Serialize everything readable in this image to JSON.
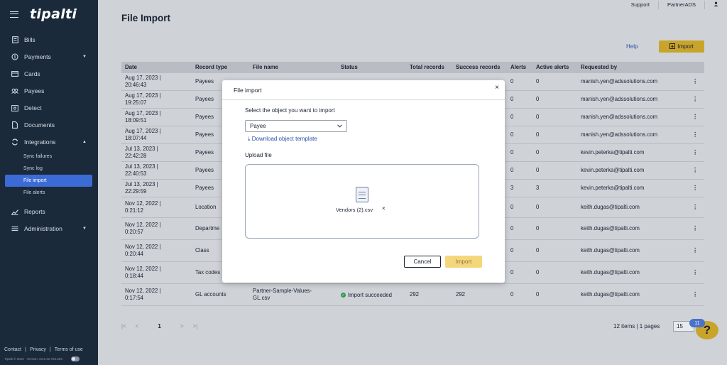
{
  "app": {
    "logo": "tipalti"
  },
  "topbar": {
    "support": "Support",
    "partner": "PartnerADS"
  },
  "sidebar": {
    "items": [
      {
        "label": "Bills",
        "icon": "bills-icon"
      },
      {
        "label": "Payments",
        "icon": "payments-icon",
        "caret": "▼"
      },
      {
        "label": "Cards",
        "icon": "cards-icon"
      },
      {
        "label": "Payees",
        "icon": "payees-icon"
      },
      {
        "label": "Detect",
        "icon": "detect-icon"
      },
      {
        "label": "Documents",
        "icon": "documents-icon"
      },
      {
        "label": "Integrations",
        "icon": "integrations-icon",
        "caret": "▲"
      }
    ],
    "subitems": [
      "Sync failures",
      "Sync log",
      "File import",
      "File alerts"
    ],
    "items_after": [
      {
        "label": "Reports",
        "icon": "reports-icon"
      },
      {
        "label": "Administration",
        "icon": "administration-icon",
        "caret": "▼"
      }
    ],
    "footer": {
      "contact": "Contact",
      "privacy": "Privacy",
      "terms": "Terms of use",
      "sep": "|"
    },
    "version": {
      "copyright": "Tipalti © 2023",
      "build": "Version: 23.8.12.784.393"
    }
  },
  "page": {
    "title": "File Import",
    "help": "Help",
    "import_button": "Import"
  },
  "table": {
    "headers": [
      "Date",
      "Record type",
      "File name",
      "Status",
      "Total records",
      "Success records",
      "Alerts",
      "Active alerts",
      "Requested by"
    ],
    "rows": [
      {
        "date1": "Aug 17, 2023 |",
        "date2": "20:46:43",
        "type": "Payees",
        "file1": "",
        "file2": "",
        "status": "",
        "total": "",
        "success": "",
        "alerts": "0",
        "active": "0",
        "by": "manish.yen@adssolutions.com"
      },
      {
        "date1": "Aug 17, 2023 |",
        "date2": "19:25:07",
        "type": "Payees",
        "file1": "",
        "file2": "",
        "status": "",
        "total": "",
        "success": "",
        "alerts": "0",
        "active": "0",
        "by": "manish.yen@adssolutions.com"
      },
      {
        "date1": "Aug 17, 2023 |",
        "date2": "18:09:51",
        "type": "Payees",
        "file1": "",
        "file2": "",
        "status": "",
        "total": "",
        "success": "",
        "alerts": "0",
        "active": "0",
        "by": "manish.yen@adssolutions.com"
      },
      {
        "date1": "Aug 17, 2023 |",
        "date2": "18:07:44",
        "type": "Payees",
        "file1": "",
        "file2": "",
        "status": "",
        "total": "",
        "success": "",
        "alerts": "0",
        "active": "0",
        "by": "manish.yen@adssolutions.com"
      },
      {
        "date1": "Jul 13, 2023 |",
        "date2": "22:42:28",
        "type": "Payees",
        "file1": "",
        "file2": "",
        "status": "",
        "total": "",
        "success": "",
        "alerts": "0",
        "active": "0",
        "by": "kevin.peterka@tipalti.com"
      },
      {
        "date1": "Jul 13, 2023 |",
        "date2": "22:40:53",
        "type": "Payees",
        "file1": "",
        "file2": "",
        "status": "",
        "total": "",
        "success": "",
        "alerts": "0",
        "active": "0",
        "by": "kevin.peterka@tipalti.com"
      },
      {
        "date1": "Jul 13, 2023 |",
        "date2": "22:29:59",
        "type": "Payees",
        "file1": "",
        "file2": "",
        "status": "",
        "total": "",
        "success": "",
        "alerts": "3",
        "active": "3",
        "by": "kevin.peterka@tipalti.com"
      },
      {
        "date1": "Nov 12, 2022 |",
        "date2": "0:21:12",
        "type": "Location",
        "file1": "",
        "file2": "",
        "status": "",
        "total": "",
        "success": "",
        "alerts": "0",
        "active": "0",
        "by": "keith.dugas@tipalti.com"
      },
      {
        "date1": "Nov 12, 2022 |",
        "date2": "0:20:57",
        "type": "Departme",
        "file1": "",
        "file2": "",
        "status": "",
        "total": "",
        "success": "",
        "alerts": "0",
        "active": "0",
        "by": "keith.dugas@tipalti.com"
      },
      {
        "date1": "Nov 12, 2022 |",
        "date2": "0:20:44",
        "type": "Class",
        "file1": "",
        "file2": "",
        "status": "",
        "total": "",
        "success": "",
        "alerts": "0",
        "active": "0",
        "by": "keith.dugas@tipalti.com"
      },
      {
        "date1": "Nov 12, 2022 |",
        "date2": "0:18:44",
        "type": "Tax codes",
        "file1": "",
        "file2": "",
        "status": "",
        "total": "",
        "success": "",
        "alerts": "0",
        "active": "0",
        "by": "keith.dugas@tipalti.com"
      },
      {
        "date1": "Nov 12, 2022 |",
        "date2": "0:17:54",
        "type": "GL accounts",
        "file1": "Partner-Sample-Values-",
        "file2": "GL.csv",
        "status": "Import succeeded",
        "total": "292",
        "success": "292",
        "alerts": "0",
        "active": "0",
        "by": "keith.dugas@tipalti.com"
      }
    ]
  },
  "pager": {
    "first": "|<",
    "prev": "<",
    "current": "1",
    "next": ">",
    "last": ">|",
    "info": "12 items | 1 pages",
    "per_page": "15"
  },
  "help_widget": {
    "glyph": "?",
    "badge": "11"
  },
  "modal": {
    "title": "File import",
    "close": "×",
    "select_label": "Select the object you want to import",
    "select_value": "Payee",
    "download_link": "⤓ Download object template",
    "upload_label": "Upload file",
    "file_name": "Vendors (2).csv",
    "remove": "×",
    "cancel": "Cancel",
    "import": "Import"
  },
  "colors": {
    "sidebar": "#1b2a3b",
    "accent": "#c9a42a",
    "active_nav": "#3d6bd6",
    "link": "#2b4ea8"
  }
}
